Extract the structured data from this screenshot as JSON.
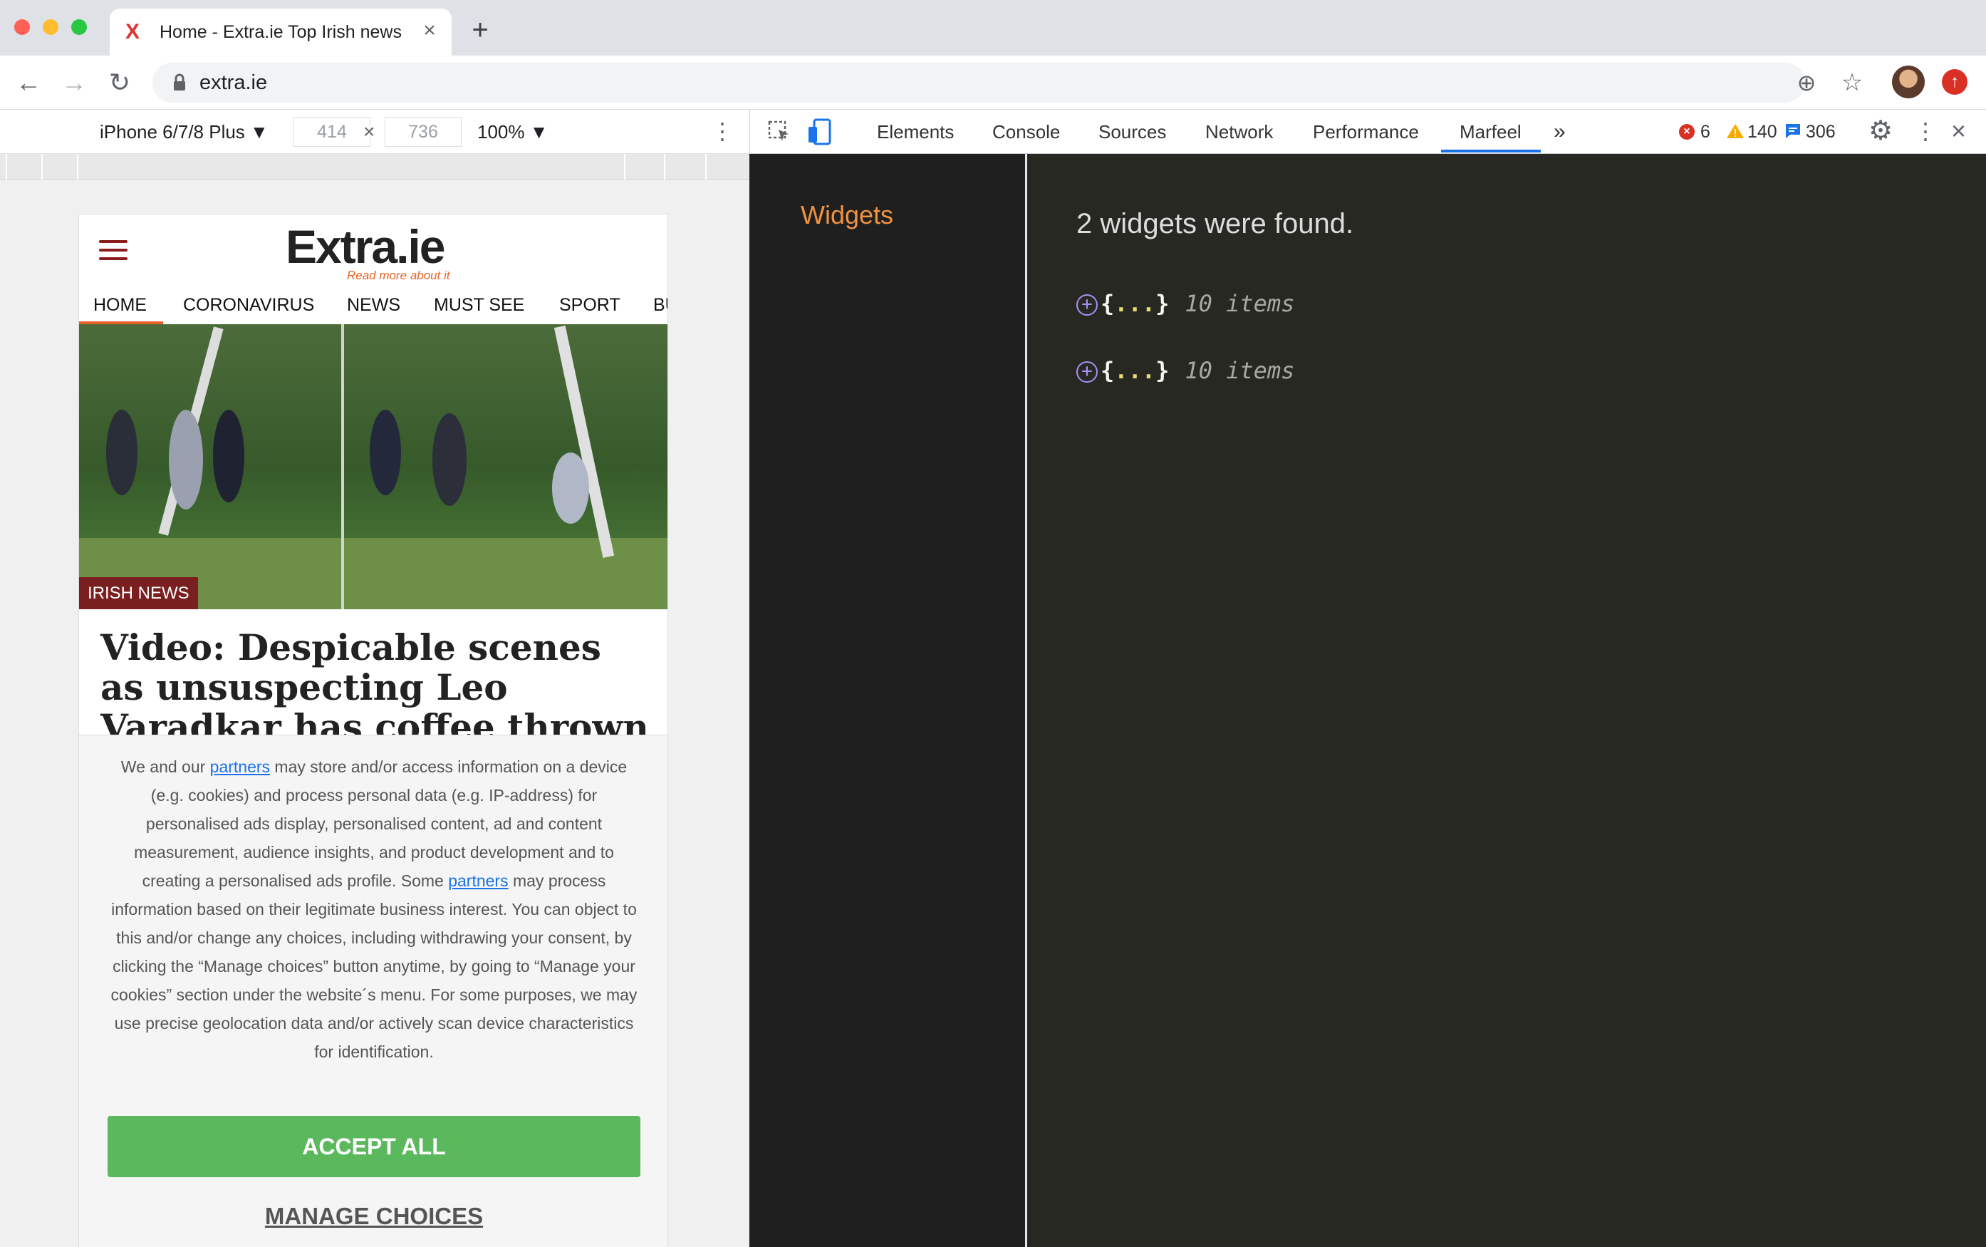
{
  "browser": {
    "tab_title": "Home - Extra.ie Top Irish news",
    "tab_favicon": "X",
    "url": "extra.ie"
  },
  "device_toolbar": {
    "device": "iPhone 6/7/8 Plus ▼",
    "width": "414",
    "height": "736",
    "times": "×",
    "zoom": "100% ▼"
  },
  "page": {
    "logo_text": "Extra.ie",
    "logo_tagline": "Read more about it",
    "nav": [
      "HOME",
      "CORONAVIRUS",
      "NEWS",
      "MUST SEE",
      "SPORT",
      "BU"
    ],
    "hero_badge": "IRISH NEWS",
    "headline": "Video: Despicable scenes as unsuspecting Leo Varadkar has coffee thrown in his face by",
    "consent": {
      "part1": "We and our ",
      "link1": "partners",
      "part2": " may store and/or access information on a device (e.g. cookies) and process personal data (e.g. IP-address) for personalised ads display, personalised content, ad and content measurement, audience insights, and product development and to creating a personalised ads profile. Some ",
      "link2": "partners",
      "part3": " may process information based on their legitimate business interest. You can object to this and/or change any choices, including withdrawing your consent, by clicking the “Manage choices” button anytime, by going to “Manage your cookies” section under the website´s menu. For some purposes, we may use precise geolocation data and/or actively scan device characteristics for identification.",
      "accept": "ACCEPT ALL",
      "manage": "MANAGE CHOICES"
    }
  },
  "devtools": {
    "tabs": [
      "Elements",
      "Console",
      "Sources",
      "Network",
      "Performance",
      "Marfeel"
    ],
    "more": "»",
    "errors": "6",
    "warnings": "140",
    "messages": "306",
    "sidebar_title": "Widgets",
    "found": "2 widgets were found.",
    "widgets": [
      {
        "open": "{",
        "dots": "...",
        "close": "}",
        "count": "10 items"
      },
      {
        "open": "{",
        "dots": "...",
        "close": "}",
        "count": "10 items"
      }
    ]
  },
  "colors": {
    "accent_orange": "#f29340",
    "brand_orange": "#e8632b",
    "accept_green": "#5cb85c",
    "devtools_active": "#1a73e8"
  }
}
